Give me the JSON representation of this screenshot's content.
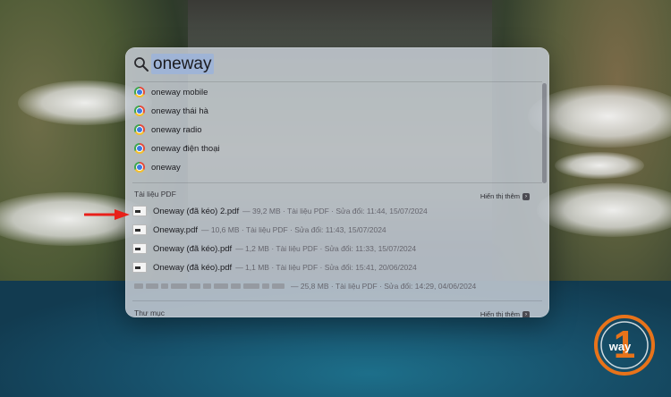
{
  "search": {
    "query": "oneway"
  },
  "suggestions": [
    {
      "label": "oneway mobile",
      "icon": "chrome-icon"
    },
    {
      "label": "oneway thái hà",
      "icon": "chrome-icon"
    },
    {
      "label": "oneway radio",
      "icon": "chrome-icon"
    },
    {
      "label": "oneway điện thoại",
      "icon": "chrome-icon"
    },
    {
      "label": "oneway",
      "icon": "chrome-icon"
    }
  ],
  "pdf_section": {
    "title": "Tài liệu PDF",
    "show_more": "Hiển thị thêm",
    "files": [
      {
        "name": "Oneway (đã kéo) 2.pdf",
        "meta": "— 39,2 MB · Tài liệu PDF · Sửa đổi: 11:44, 15/07/2024"
      },
      {
        "name": "Oneway.pdf",
        "meta": "— 10,6 MB · Tài liệu PDF · Sửa đổi: 11:43, 15/07/2024"
      },
      {
        "name": "Oneway (đã kéo).pdf",
        "meta": "— 1,2 MB · Tài liệu PDF · Sửa đổi: 11:33, 15/07/2024"
      },
      {
        "name": "Oneway (đã kéo).pdf",
        "meta": "— 1,1 MB · Tài liệu PDF · Sửa đổi: 15:41, 20/06/2024"
      },
      {
        "name": "",
        "meta": "— 25,8 MB · Tài liệu PDF · Sửa đổi: 14:29, 04/06/2024"
      }
    ]
  },
  "folder_section": {
    "title": "Thư mục",
    "show_more": "Hiển thị thêm"
  },
  "logo": {
    "text": "way",
    "number": "1"
  },
  "colors": {
    "accent_highlight": "#9fb4d6",
    "arrow": "#e8201a",
    "logo": "#e8731a"
  }
}
